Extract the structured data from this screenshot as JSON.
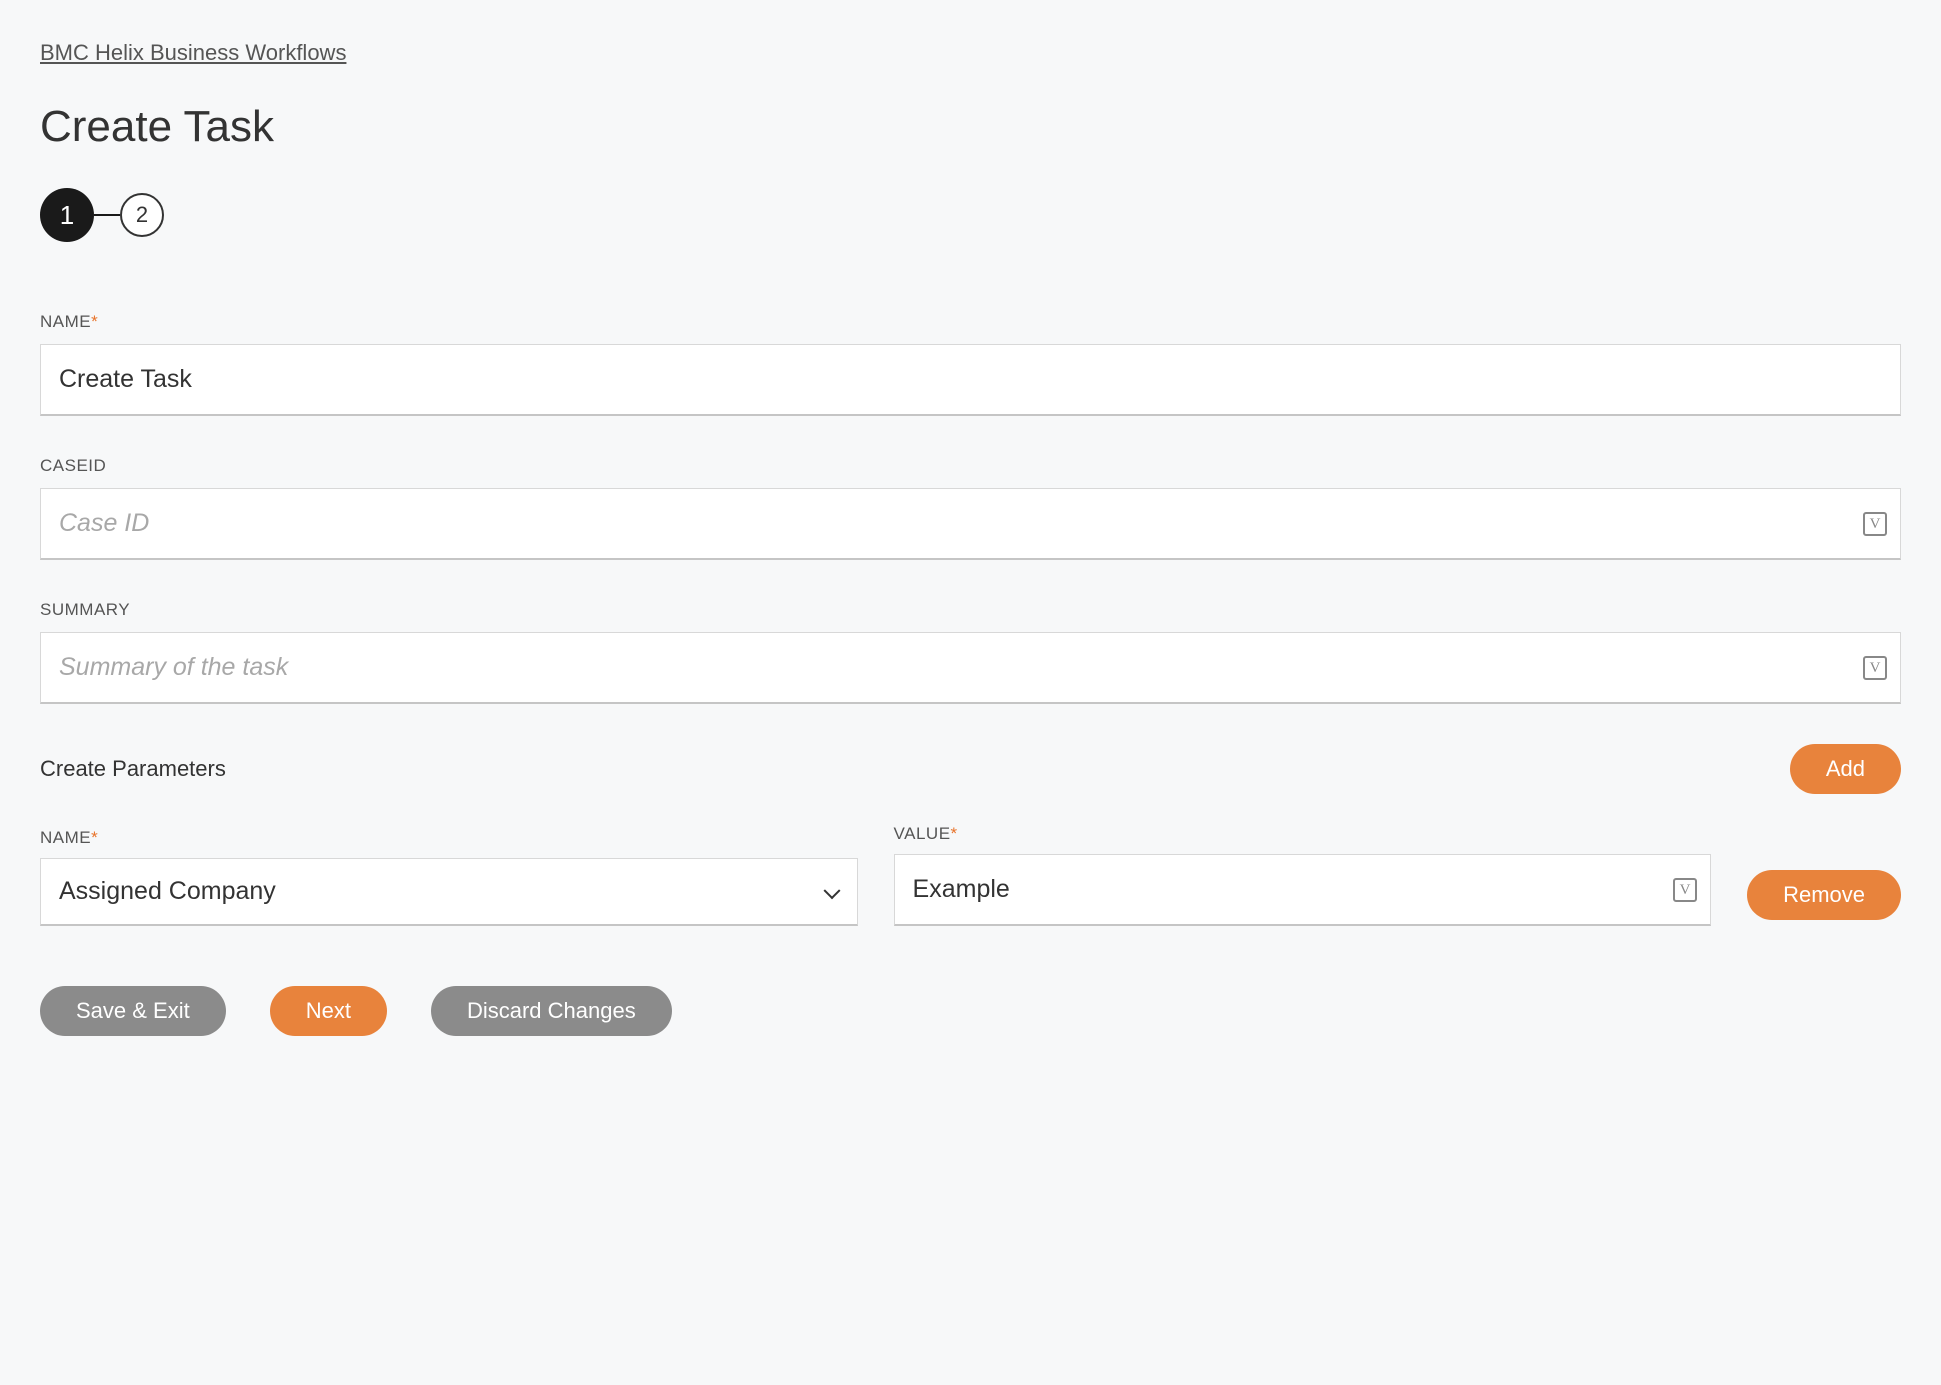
{
  "breadcrumb": "BMC Helix Business Workflows",
  "page_title": "Create Task",
  "stepper": {
    "steps": [
      "1",
      "2"
    ],
    "active_index": 0
  },
  "fields": {
    "name": {
      "label": "NAME",
      "required": true,
      "value": "Create Task"
    },
    "caseid": {
      "label": "CASEID",
      "required": false,
      "placeholder": "Case ID",
      "value": ""
    },
    "summary": {
      "label": "SUMMARY",
      "required": false,
      "placeholder": "Summary of the task",
      "value": ""
    }
  },
  "parameters": {
    "section_label": "Create Parameters",
    "add_label": "Add",
    "remove_label": "Remove",
    "name_label": "NAME",
    "value_label": "VALUE",
    "rows": [
      {
        "name": "Assigned Company",
        "value": "Example"
      }
    ]
  },
  "footer": {
    "save_exit": "Save & Exit",
    "next": "Next",
    "discard": "Discard Changes"
  },
  "icons": {
    "variable": "V"
  }
}
